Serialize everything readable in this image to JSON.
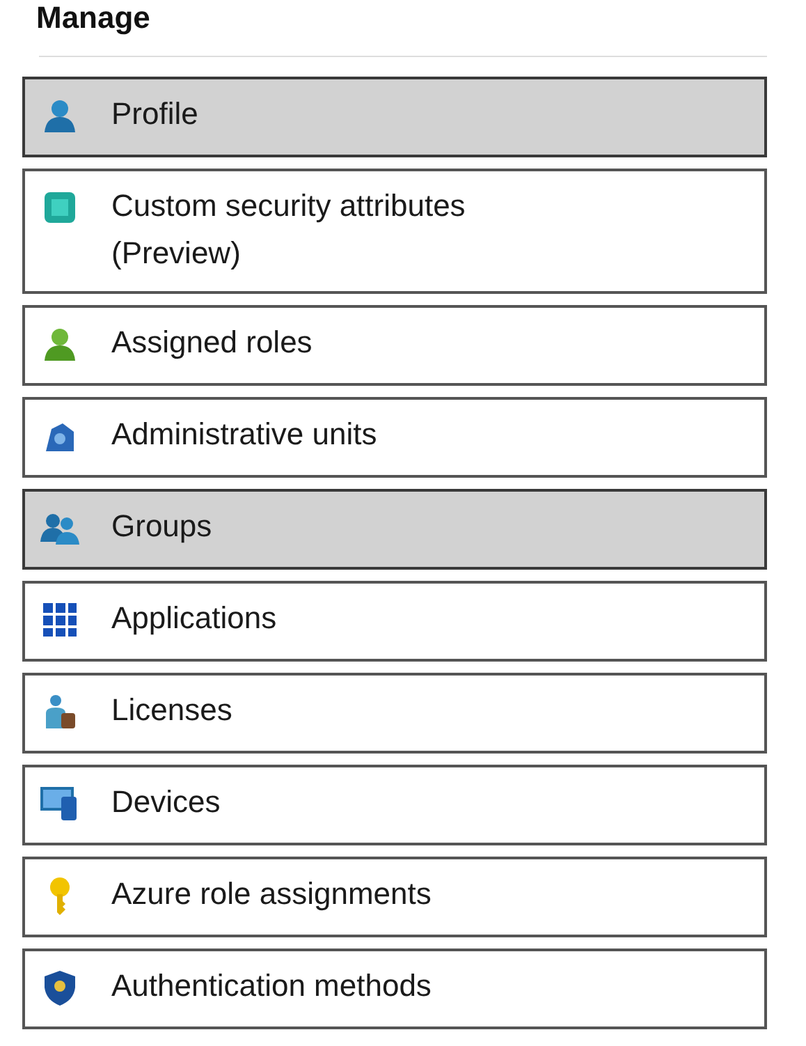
{
  "heading": "Manage",
  "items": [
    {
      "label": "Profile",
      "kind": "person",
      "selected": true
    },
    {
      "label": "Custom security attributes (Preview)",
      "kind": "attributes",
      "selected": false
    },
    {
      "label": "Assigned roles",
      "kind": "role",
      "selected": false
    },
    {
      "label": "Administrative units",
      "kind": "units",
      "selected": false
    },
    {
      "label": "Groups",
      "kind": "group",
      "selected": true
    },
    {
      "label": "Applications",
      "kind": "apps",
      "selected": false
    },
    {
      "label": "Licenses",
      "kind": "licenses",
      "selected": false
    },
    {
      "label": "Devices",
      "kind": "devices",
      "selected": false
    },
    {
      "label": "Azure role assignments",
      "kind": "key",
      "selected": false
    },
    {
      "label": "Authentication methods",
      "kind": "shield",
      "selected": false
    }
  ]
}
